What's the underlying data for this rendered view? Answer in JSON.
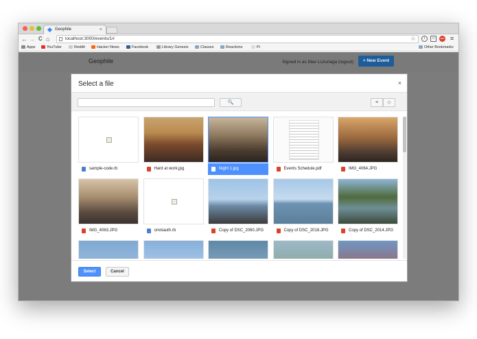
{
  "browser": {
    "tab_title": "Geophile",
    "tab_close": "×",
    "url": "localhost:3000/events/1#",
    "nav": {
      "back": "←",
      "forward": "→",
      "reload": "C",
      "home": "⌂"
    },
    "toolbar_icons": [
      "i",
      "□",
      "ABP",
      "≡"
    ],
    "bookmarks": [
      {
        "label": "Apps",
        "color": "#888888"
      },
      {
        "label": "YouTube",
        "color": "#e52d27"
      },
      {
        "label": "Reddit",
        "color": "#cccccc"
      },
      {
        "label": "Hacker News",
        "color": "#ff6600"
      },
      {
        "label": "Facebook",
        "color": "#3b5998"
      },
      {
        "label": "Library Genesis",
        "color": "#999999"
      },
      {
        "label": "Classes",
        "color": "#8aa4c8"
      },
      {
        "label": "Reactions",
        "color": "#8aa4c8"
      },
      {
        "label": "Pi",
        "color": "#dddddd"
      }
    ],
    "other_bookmarks": "Other Bookmarks"
  },
  "app": {
    "brand": "Geophile",
    "signed_in": "Signed in as Max Luzuriaga (logout)",
    "new_event": "+ New Event",
    "accent": "#1e5d99"
  },
  "modal": {
    "title": "Select a file",
    "close": "×",
    "search_placeholder": "",
    "search_icon": "🔍",
    "view_list_icon": "≡",
    "view_map_icon": "◇",
    "select_label": "Select",
    "cancel_label": "Cancel",
    "selected_color": "#4d90fe"
  },
  "files": [
    {
      "name": "sample-code.rb",
      "kind": "doc",
      "thumb": "broken",
      "selected": false
    },
    {
      "name": "Hard at work.jpg",
      "kind": "image",
      "thumb": "room",
      "selected": false
    },
    {
      "name": "Night 1.jpg",
      "kind": "image",
      "thumb": "night",
      "selected": true
    },
    {
      "name": "Events Schedule.pdf",
      "kind": "pdf",
      "thumb": "paper",
      "selected": false
    },
    {
      "name": "IMG_4064.JPG",
      "kind": "image",
      "thumb": "table",
      "selected": false
    },
    {
      "name": "IMG_4063.JPG",
      "kind": "image",
      "thumb": "crowd",
      "selected": false
    },
    {
      "name": "omniauth.rb",
      "kind": "doc",
      "thumb": "broken",
      "selected": false
    },
    {
      "name": "Copy of DSC_2060.JPG",
      "kind": "image",
      "thumb": "boat",
      "selected": false
    },
    {
      "name": "Copy of DSC_2018.JPG",
      "kind": "image",
      "thumb": "water",
      "selected": false
    },
    {
      "name": "Copy of DSC_2014.JPG",
      "kind": "image",
      "thumb": "trees",
      "selected": false
    },
    {
      "name": "",
      "kind": "image",
      "thumb": "sky1",
      "selected": false
    },
    {
      "name": "",
      "kind": "image",
      "thumb": "sky2",
      "selected": false
    },
    {
      "name": "",
      "kind": "image",
      "thumb": "sky3",
      "selected": false
    },
    {
      "name": "",
      "kind": "image",
      "thumb": "sky4",
      "selected": false
    },
    {
      "name": "",
      "kind": "image",
      "thumb": "sky5",
      "selected": false
    }
  ]
}
